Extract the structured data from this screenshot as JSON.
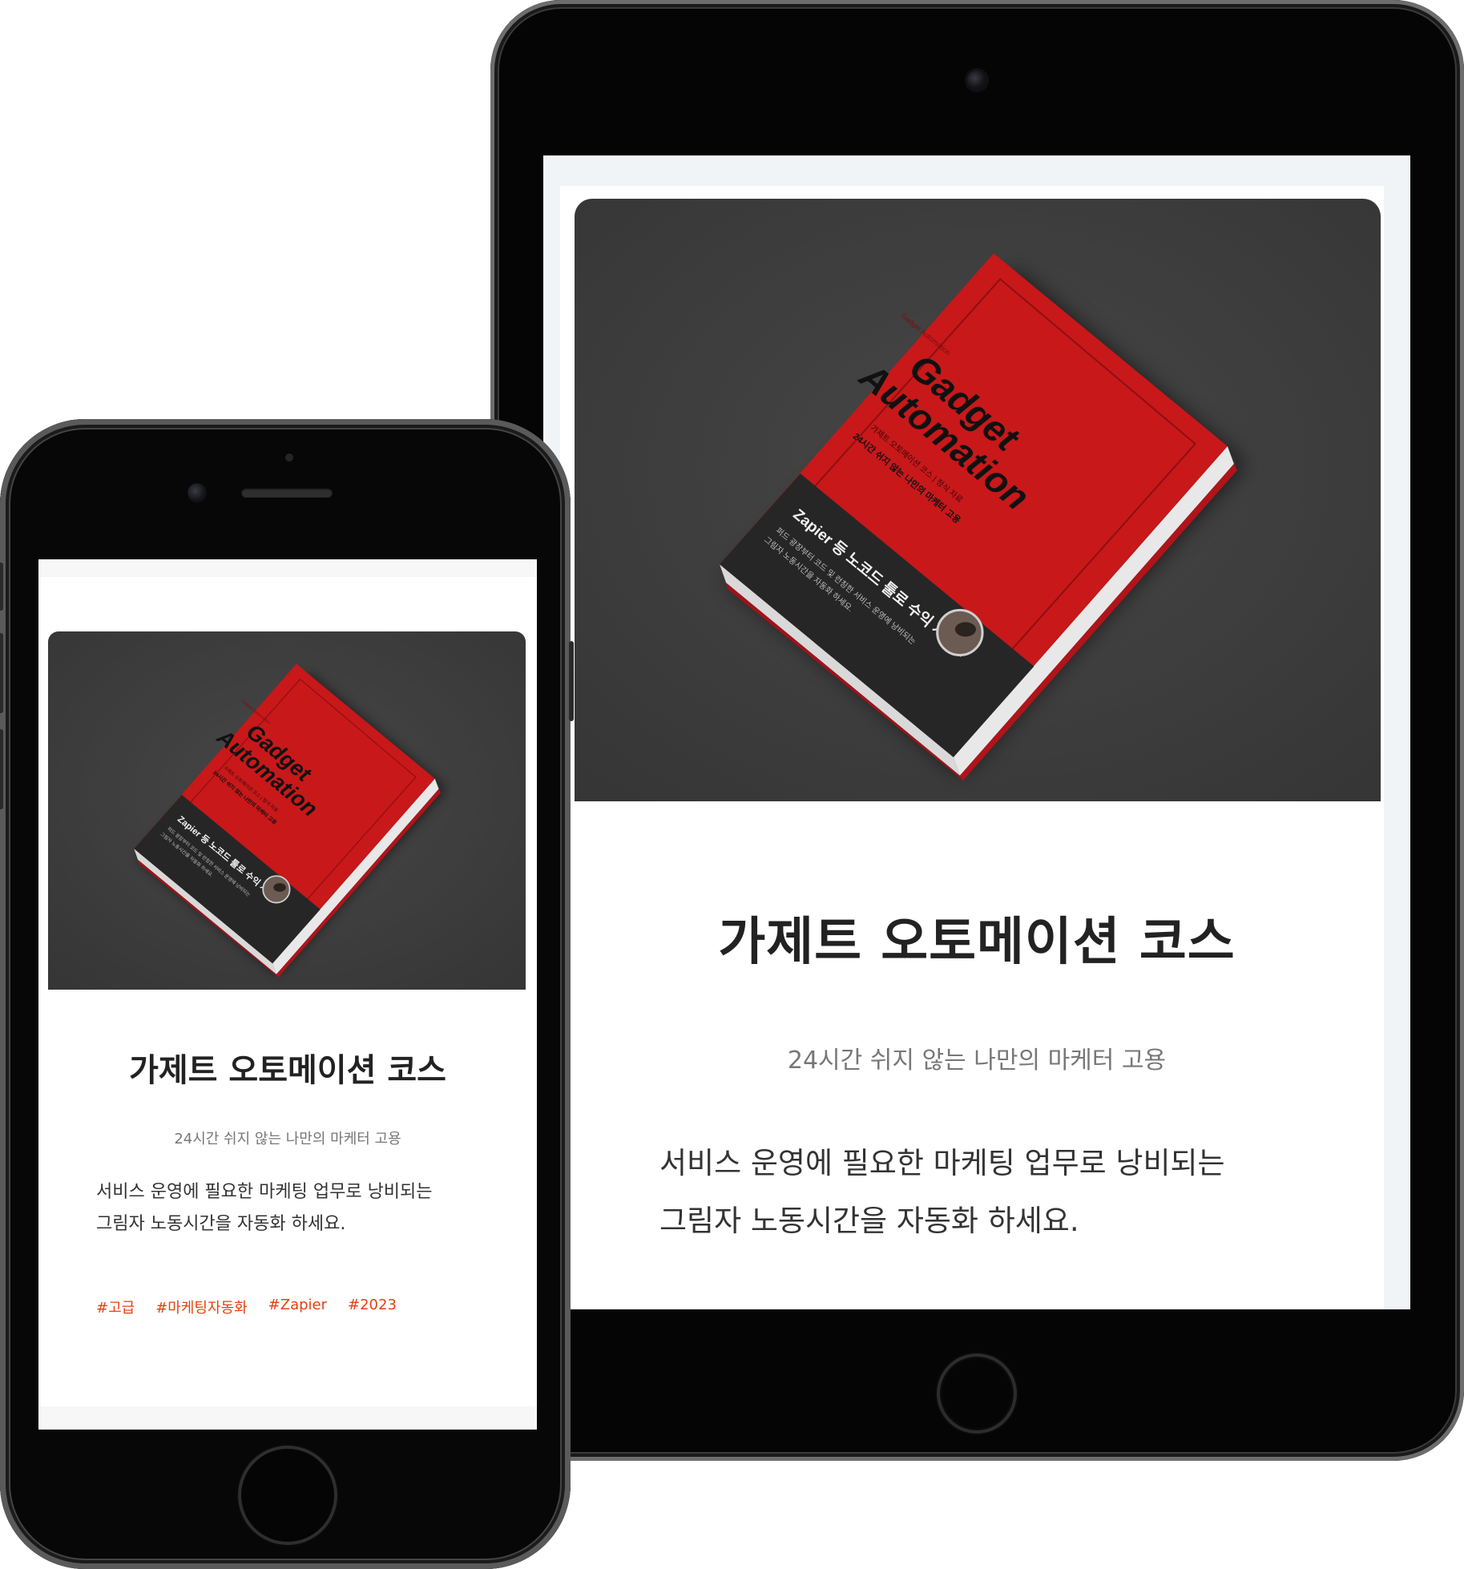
{
  "course": {
    "title": "가제트 오토메이션 코스",
    "subtitle": "24시간 쉬지 않는 나만의 마케터 고용",
    "description_lines": [
      "서비스 운영에 필요한 마케팅 업무로 낭비되는",
      "그림자 노동시간을 자동화 하세요."
    ],
    "tags": [
      "#고급",
      "#마케팅자동화",
      "#Zapier",
      "#2023"
    ]
  },
  "book_cover": {
    "author": "Gadget Automation",
    "title_line1": "Gadget",
    "title_line2": "Automation",
    "tagline1": "가제트 오토메이션 코스 | 정식 자료",
    "tagline2": "24시간 쉬지 않는 나만의 마케터 고용",
    "band_title": "Zapier 등 노코드 툴로 수익 자동화",
    "band_line1": "퍼드 광장부터 코드 및 런칭한 서비스 운영에 낭비되는",
    "band_line2": "그림자 노동시간을 자동화 하세요."
  },
  "colors": {
    "accent": "#e2420f",
    "book_red": "#c8181a",
    "book_band": "#262626",
    "hero_bg": "#3f3f3f"
  },
  "icons": [
    "tablet-camera-icon",
    "phone-camera-icon",
    "phone-speaker-icon",
    "home-button-icon"
  ]
}
